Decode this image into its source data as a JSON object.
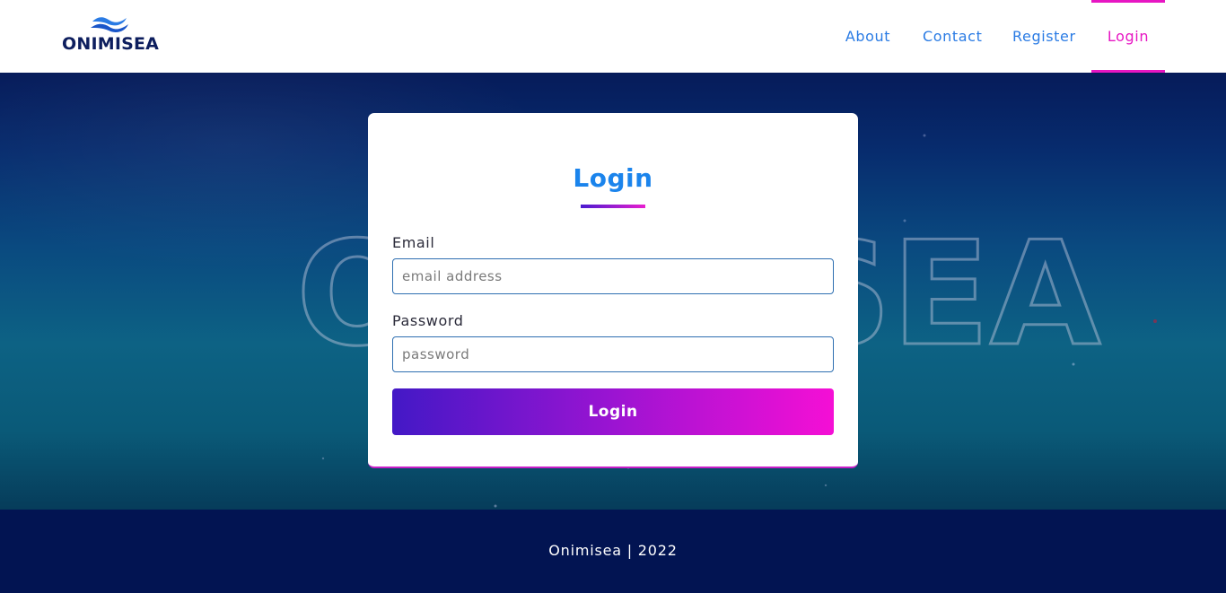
{
  "brand": {
    "name": "ONIMISEA",
    "logo_icon": "waves-icon",
    "primary_color": "#0d1e5e",
    "accent_color": "#e716c3"
  },
  "nav": {
    "items": [
      {
        "label": "About",
        "active": false
      },
      {
        "label": "Contact",
        "active": false
      },
      {
        "label": "Register",
        "active": false
      },
      {
        "label": "Login",
        "active": true
      }
    ]
  },
  "hero": {
    "background_watermark": "ONIMISEA"
  },
  "login_form": {
    "title": "Login",
    "email": {
      "label": "Email",
      "placeholder": "email address",
      "value": ""
    },
    "password": {
      "label": "Password",
      "placeholder": "password",
      "value": ""
    },
    "submit_label": "Login"
  },
  "footer": {
    "text": "Onimisea | 2022"
  }
}
